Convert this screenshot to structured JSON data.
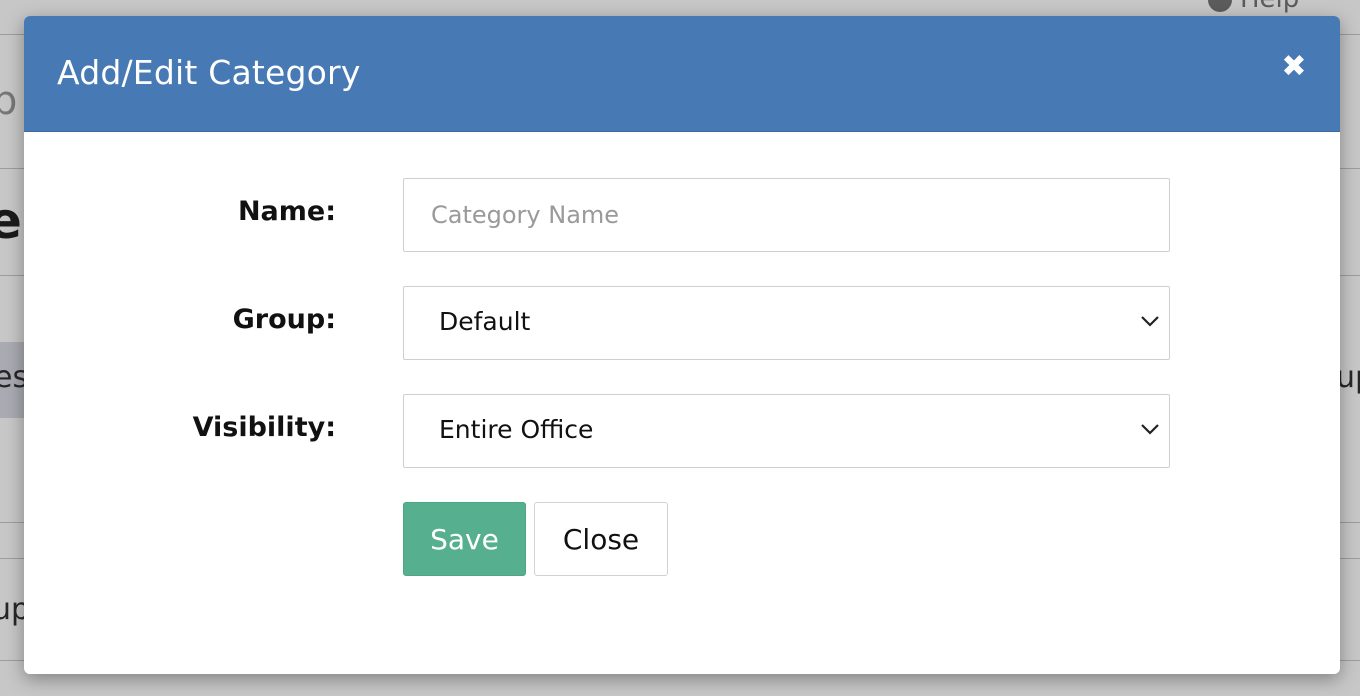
{
  "background": {
    "help_label": "Help",
    "fragment_top": "p",
    "fragment_heading": "eg",
    "fragment_row": "es",
    "fragment_right": "up",
    "fragment_bottom": "up"
  },
  "modal": {
    "title": "Add/Edit Category",
    "close_icon": "times-icon",
    "fields": {
      "name": {
        "label": "Name:",
        "placeholder": "Category Name",
        "value": ""
      },
      "group": {
        "label": "Group:",
        "value": "Default"
      },
      "visibility": {
        "label": "Visibility:",
        "value": "Entire Office"
      }
    },
    "buttons": {
      "save": "Save",
      "close": "Close"
    }
  },
  "colors": {
    "header": "#4779b4",
    "save_button": "#56b08f"
  }
}
